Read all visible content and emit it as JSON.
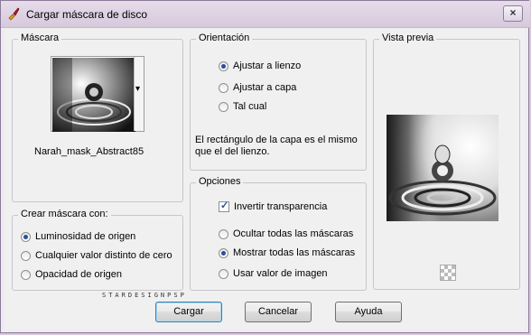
{
  "window": {
    "title": "Cargar máscara de disco",
    "close_symbol": "×"
  },
  "mask_group": {
    "title": "Máscara",
    "mask_name": "Narah_mask_Abstract85",
    "dropdown_arrow": "▾"
  },
  "orientation_group": {
    "title": "Orientación",
    "options": [
      "Ajustar a lienzo",
      "Ajustar a capa",
      "Tal cual"
    ],
    "selected_index": 0,
    "description": "El rectángulo de la capa es el mismo que el del lienzo."
  },
  "preview_group": {
    "title": "Vista previa"
  },
  "create_group": {
    "title": "Crear máscara con:",
    "options": [
      "Luminosidad de origen",
      "Cualquier valor distinto de cero",
      "Opacidad de origen"
    ],
    "selected_index": 0
  },
  "options_group": {
    "title": "Opciones",
    "invert_label": "Invertir transparencia",
    "invert_checked": true,
    "radios": [
      "Ocultar todas las máscaras",
      "Mostrar todas las máscaras",
      "Usar valor de imagen"
    ],
    "selected_index": 1
  },
  "buttons": {
    "load": "Cargar",
    "cancel": "Cancelar",
    "help": "Ayuda"
  },
  "watermark": "STARDESIGNPSP",
  "icons": {
    "app": "paint-brush-icon",
    "close": "close-icon",
    "dropdown": "chevron-down-icon",
    "transparency": "checkerboard-icon"
  },
  "colors": {
    "title_bar": "#d6c9dc",
    "radio_accent": "#2c4d9a",
    "default_button_border": "#3c7fb1"
  }
}
